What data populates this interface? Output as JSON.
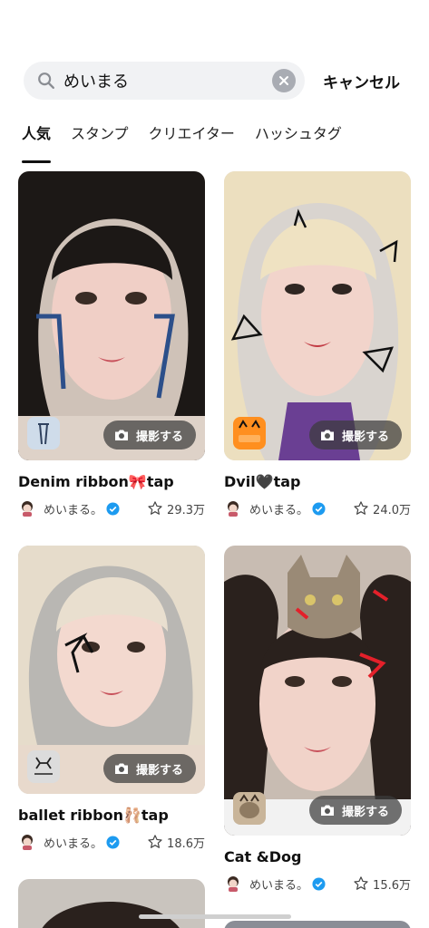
{
  "search": {
    "query": "めいまる",
    "cancel_label": "キャンセル"
  },
  "tabs": [
    {
      "label": "人気",
      "active": true
    },
    {
      "label": "スタンプ",
      "active": false
    },
    {
      "label": "クリエイター",
      "active": false
    },
    {
      "label": "ハッシュタグ",
      "active": false
    }
  ],
  "shoot_label": "撮影する",
  "effects": [
    {
      "title": "Denim ribbon🎀tap",
      "author": "めいまる。",
      "likes": "29.3万",
      "badge_icon": "ribbon-icon"
    },
    {
      "title": "Dvil🖤tap",
      "author": "めいまる。",
      "likes": "24.0万",
      "badge_icon": "devil-cat-icon"
    },
    {
      "title": "ballet ribbon🩰tap",
      "author": "めいまる。",
      "likes": "18.6万",
      "badge_icon": "ballet-ribbon-icon"
    },
    {
      "title": "Cat &Dog",
      "author": "めいまる。",
      "likes": "15.6万",
      "badge_icon": "cat-dog-icon"
    }
  ],
  "colors": {
    "accent": "#111111",
    "verified": "#1d9bf0",
    "search_bg": "#f1f2f4"
  }
}
